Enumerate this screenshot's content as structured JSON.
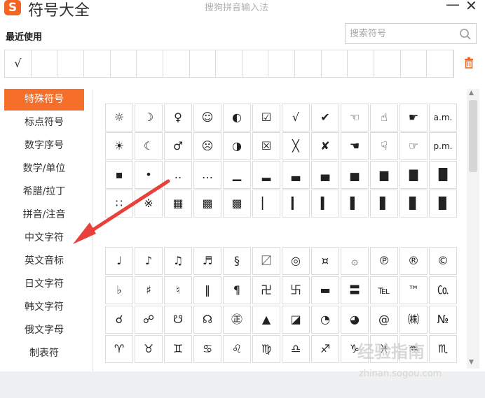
{
  "titlebar": {
    "logo": "S",
    "app_title": "符号大全",
    "window_title": "搜狗拼音输入法",
    "minimize": "—",
    "close": "✕"
  },
  "recent": {
    "heading": "最近使用",
    "items": [
      "√",
      "",
      "",
      "",
      "",
      "",
      "",
      "",
      "",
      "",
      "",
      "",
      "",
      "",
      "",
      "",
      ""
    ]
  },
  "search": {
    "placeholder": "搜索符号"
  },
  "sidebar": {
    "items": [
      {
        "label": "特殊符号",
        "active": true
      },
      {
        "label": "标点符号"
      },
      {
        "label": "数字序号"
      },
      {
        "label": "数学/单位"
      },
      {
        "label": "希腊/拉丁"
      },
      {
        "label": "拼音/注音"
      },
      {
        "label": "中文字符"
      },
      {
        "label": "英文音标"
      },
      {
        "label": "日文字符"
      },
      {
        "label": "韩文字符"
      },
      {
        "label": "俄文字母"
      },
      {
        "label": "制表符"
      }
    ]
  },
  "panel1": {
    "rows": [
      [
        "☼",
        "☽",
        "♀",
        "☺",
        "◐",
        "☑",
        "√",
        "✔",
        "☜",
        "☝",
        "☛",
        "a.m."
      ],
      [
        "☀",
        "☾",
        "♂",
        "☹",
        "◑",
        "☒",
        "╳",
        "✘",
        "☚",
        "☟",
        "☞",
        "p.m."
      ],
      [
        "▪",
        "•",
        "‥",
        "…",
        "▁",
        "▂",
        "▃",
        "▄",
        "▅",
        "▆",
        "▇",
        "█"
      ],
      [
        "∷",
        "※",
        "▦",
        "▩",
        "▩",
        "▏",
        "▎",
        "▍",
        "▌",
        "▋",
        "▊",
        "▉"
      ]
    ]
  },
  "panel2": {
    "rows": [
      [
        "♩",
        "♪",
        "♫",
        "♬",
        "§",
        "〼",
        "◎",
        "¤",
        "۞",
        "℗",
        "®",
        "©"
      ],
      [
        "♭",
        "♯",
        "♮",
        "‖",
        "¶",
        "卍",
        "卐",
        "▬",
        "〓",
        "℡",
        "™",
        "㏇"
      ],
      [
        "☌",
        "☍",
        "☋",
        "☊",
        "㊣",
        "▲",
        "◪",
        "◔",
        "◕",
        "@",
        "㈱",
        "№"
      ],
      [
        "♈",
        "♉",
        "♊",
        "♋",
        "♌",
        "♍",
        "♎",
        "♐",
        "♑",
        "♓",
        "♒",
        "♏"
      ]
    ]
  },
  "watermark": {
    "logo": "经验指南",
    "text": "zhinan.sogou.com"
  },
  "colors": {
    "accent": "#f56f2a",
    "arrow": "#e8413c"
  },
  "icons": {
    "search": "search-icon",
    "trash": "trash-icon",
    "arrow": "red-arrow-annotation"
  }
}
